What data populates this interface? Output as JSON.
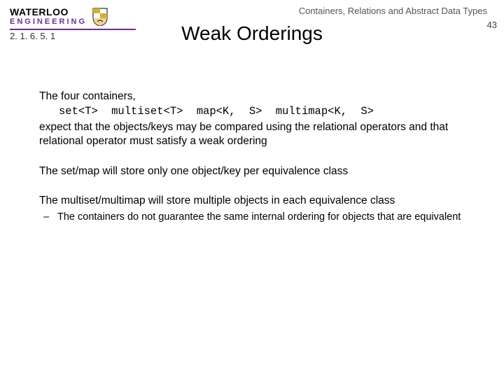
{
  "header": {
    "chapter": "Containers, Relations and Abstract Data Types",
    "page_number": "43",
    "section_number": "2. 1. 6. 5. 1",
    "logo_top": "WATERLOO",
    "logo_bottom": "ENGINEERING"
  },
  "title": "Weak Orderings",
  "body": {
    "p1_intro": "The four containers,",
    "p1_code": "set<T>  multiset<T>  map<K, S>  multimap<K, S>",
    "p1_rest": "expect that the objects/keys may be compared using the relational operators and that relational operator must satisfy a weak ordering",
    "p2": "The set/map will store only one object/key per equivalence class",
    "p3": "The multiset/multimap will store multiple objects in each equivalence class",
    "p3_sub": "The containers do not guarantee the same internal ordering for objects that are equivalent"
  }
}
